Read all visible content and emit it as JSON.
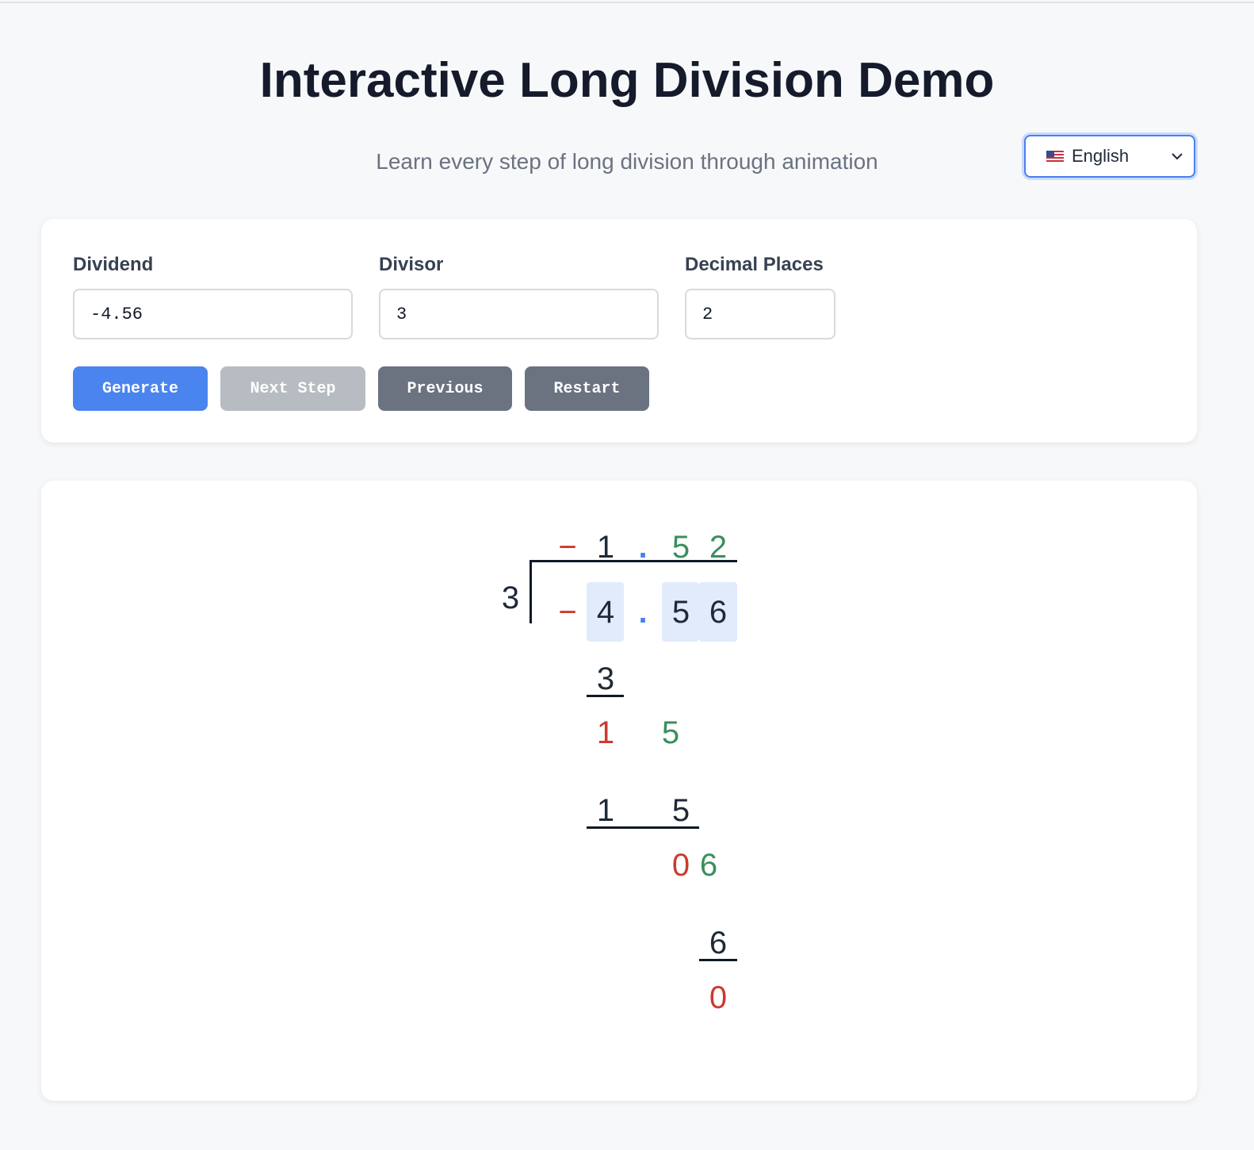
{
  "header": {
    "title": "Interactive Long Division Demo",
    "subtitle": "Learn every step of long division through animation"
  },
  "language": {
    "selected": "English",
    "flag": "us-flag"
  },
  "form": {
    "dividend_label": "Dividend",
    "dividend_value": "-4.56",
    "divisor_label": "Divisor",
    "divisor_value": "3",
    "decimals_label": "Decimal Places",
    "decimals_value": "2"
  },
  "buttons": {
    "generate": "Generate",
    "next": "Next Step",
    "previous": "Previous",
    "restart": "Restart"
  },
  "division": {
    "divisor": "3",
    "quotient": {
      "sign": "−",
      "d1": "1",
      "dot": ".",
      "d2": "5",
      "d3": "2"
    },
    "dividend": {
      "sign": "−",
      "d1": "4",
      "dot": ".",
      "d2": "5",
      "d3": "6"
    },
    "steps": {
      "s1_sub": "3",
      "s1_rem": "1",
      "s1_bring": "5",
      "s2_sub_a": "1",
      "s2_sub_b": "5",
      "s2_rem": "0",
      "s2_bring": "6",
      "s3_sub": "6",
      "s3_rem": "0"
    }
  },
  "colors": {
    "accent": "#4a84ee",
    "brought_down": "#3a8f5d",
    "remainder": "#cc3a2e",
    "highlight": "#e1ebfc"
  }
}
